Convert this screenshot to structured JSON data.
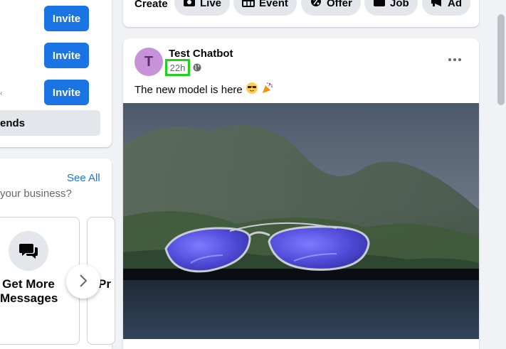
{
  "left": {
    "invite_label": "Invite",
    "friends_label": "ends",
    "see_all": "See All",
    "business_question": "your business?",
    "tile1_label_line1": "Get More",
    "tile1_label_line2": "Messages",
    "tile2_label": "Pr"
  },
  "create": {
    "label": "Create",
    "items": [
      {
        "label": "Live",
        "icon": "live-video-icon"
      },
      {
        "label": "Event",
        "icon": "calendar-icon"
      },
      {
        "label": "Offer",
        "icon": "percent-tag-icon"
      },
      {
        "label": "Job",
        "icon": "briefcase-icon"
      },
      {
        "label": "Ad",
        "icon": "megaphone-icon"
      }
    ]
  },
  "post": {
    "avatar_initial": "T",
    "author": "Test Chatbot",
    "time": "22h",
    "privacy_icon": "globe-icon",
    "text": "The new model is here",
    "emojis": [
      "sunglasses-emoji",
      "party-popper-emoji"
    ]
  },
  "colors": {
    "accent": "#1b74e4",
    "highlight": "#22d11a",
    "avatar_bg": "#c792d9"
  }
}
